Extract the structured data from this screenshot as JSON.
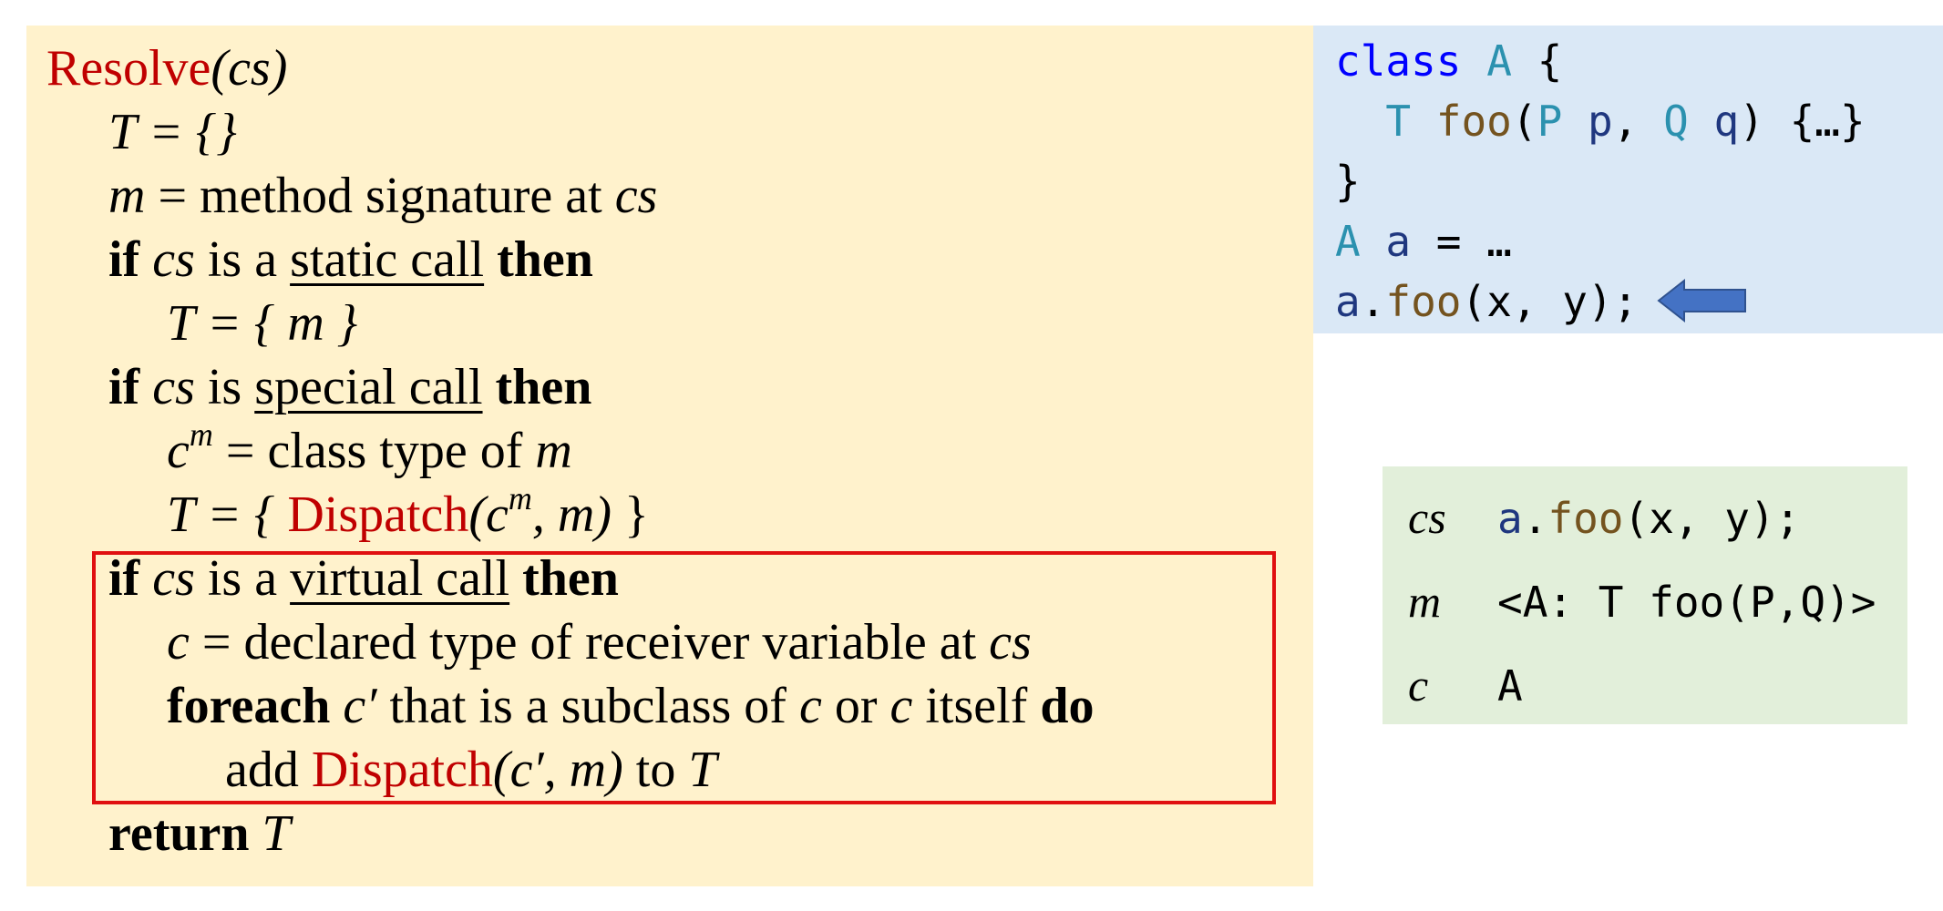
{
  "algorithm": {
    "title_fn": "Resolve",
    "title_args": "(cs)",
    "l1": "T = {}",
    "l2_a": "m",
    "l2_b": " = method signature at ",
    "l2_c": "cs",
    "if": "if",
    "then": "then",
    "cs": "cs",
    "l3_mid": " is a ",
    "static_call": "static call",
    "l4": "T = { m }",
    "l5_mid": " is ",
    "special_call": "special call",
    "l6_c": "c",
    "l6_sup": "m",
    "l6_rest": " = class type of ",
    "l6_m": "m",
    "l7_pre": "T = { ",
    "dispatch": "Dispatch",
    "l7_args": "(c",
    "l7_sup": "m",
    "l7_args2": ", m)",
    "l7_post": " }",
    "virtual_call": "virtual call",
    "l9_c": "c",
    "l9_rest": " = declared type of receiver variable at ",
    "l9_cs": "cs",
    "foreach": "foreach",
    "l10_c1": "c′",
    "l10_mid": " that is a subclass of ",
    "l10_c2": "c",
    "l10_or": " or ",
    "l10_c3": "c",
    "l10_itself": " itself  ",
    "do": "do",
    "l11_add": "add ",
    "l11_args": "(c′, m)",
    "l11_to": " to ",
    "l11_T": "T",
    "return": "return",
    "ret_T": "T"
  },
  "code": {
    "class_kw": "class",
    "class_name": "A",
    "brace_open": " {",
    "indent": "  ",
    "ret_type": "T",
    "method": "foo",
    "paren_open": "(",
    "p_type": "P",
    "p_name": "p",
    "comma": ", ",
    "q_type": "Q",
    "q_name": "q",
    "method_body": ") {…}",
    "brace_close": "}",
    "decl_type": "A",
    "decl_var": "a",
    "decl_rest": " = …",
    "call_var": "a",
    "call_dot": ".",
    "call_method": "foo",
    "call_args": "(x, y);"
  },
  "info": {
    "rows": [
      {
        "sym": "cs",
        "var": "a",
        "dot": ".",
        "method": "foo",
        "rest": "(x, y);"
      },
      {
        "sym": "m",
        "text": "<A: T foo(P,Q)>"
      },
      {
        "sym": "c",
        "type": "A"
      }
    ]
  },
  "colors": {
    "algorithm_bg": "#fff2cc",
    "code_bg": "#dae8f6",
    "info_bg": "#e2efda",
    "highlight_box": "#e01010",
    "arrow": "#4472c4",
    "dispatch_red": "#c00000"
  },
  "icons": {
    "arrow": "left-arrow-icon"
  }
}
